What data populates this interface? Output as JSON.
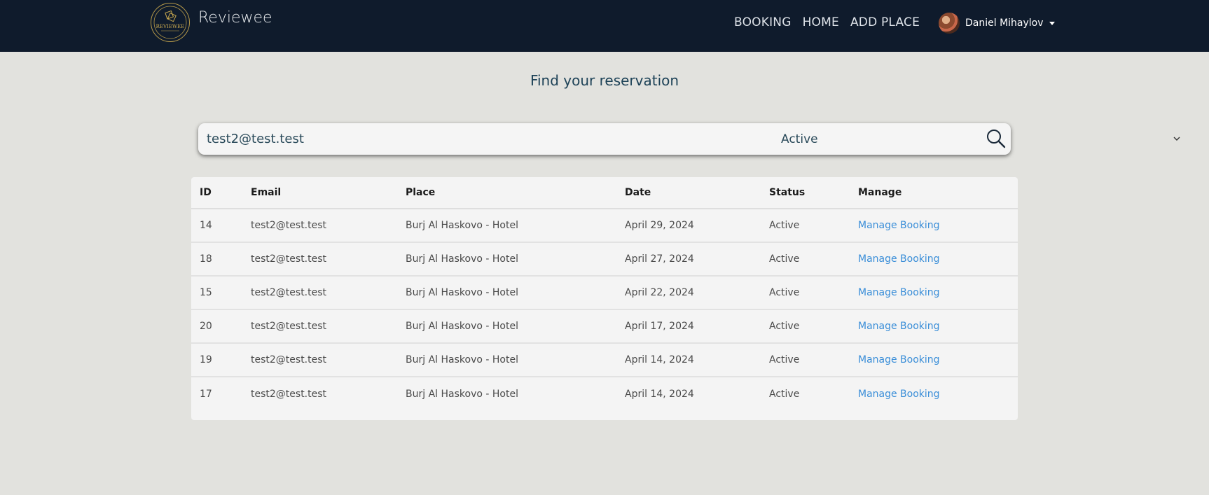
{
  "navbar": {
    "brand": "Reviewee",
    "links": [
      "BOOKING",
      "HOME",
      "ADD PLACE"
    ],
    "user_name": "Daniel Mihaylov"
  },
  "page": {
    "title": "Find your reservation"
  },
  "search": {
    "value": "test2@test.test",
    "status_selected": "Active"
  },
  "table": {
    "columns": [
      "ID",
      "Email",
      "Place",
      "Date",
      "Status",
      "Manage"
    ],
    "rows": [
      [
        "14",
        "test2@test.test",
        "Burj Al Haskovo - Hotel",
        "April 29, 2024",
        "Active",
        "Manage Booking"
      ],
      [
        "18",
        "test2@test.test",
        "Burj Al Haskovo - Hotel",
        "April 27, 2024",
        "Active",
        "Manage Booking"
      ],
      [
        "15",
        "test2@test.test",
        "Burj Al Haskovo - Hotel",
        "April 22, 2024",
        "Active",
        "Manage Booking"
      ],
      [
        "20",
        "test2@test.test",
        "Burj Al Haskovo - Hotel",
        "April 17, 2024",
        "Active",
        "Manage Booking"
      ],
      [
        "19",
        "test2@test.test",
        "Burj Al Haskovo - Hotel",
        "April 14, 2024",
        "Active",
        "Manage Booking"
      ],
      [
        "17",
        "test2@test.test",
        "Burj Al Haskovo - Hotel",
        "April 14, 2024",
        "Active",
        "Manage Booking"
      ]
    ]
  },
  "colors": {
    "navbar": "#0f1b2c",
    "background": "#e2e2de",
    "link": "#3a8ed8",
    "title": "#1d4257"
  },
  "icons": {
    "logo": "reviewee-logo-icon",
    "search": "search-icon",
    "dropdown": "chevron-down-icon",
    "user_menu": "caret-down-icon"
  },
  "logo": {
    "text": "REVIEWEE"
  }
}
